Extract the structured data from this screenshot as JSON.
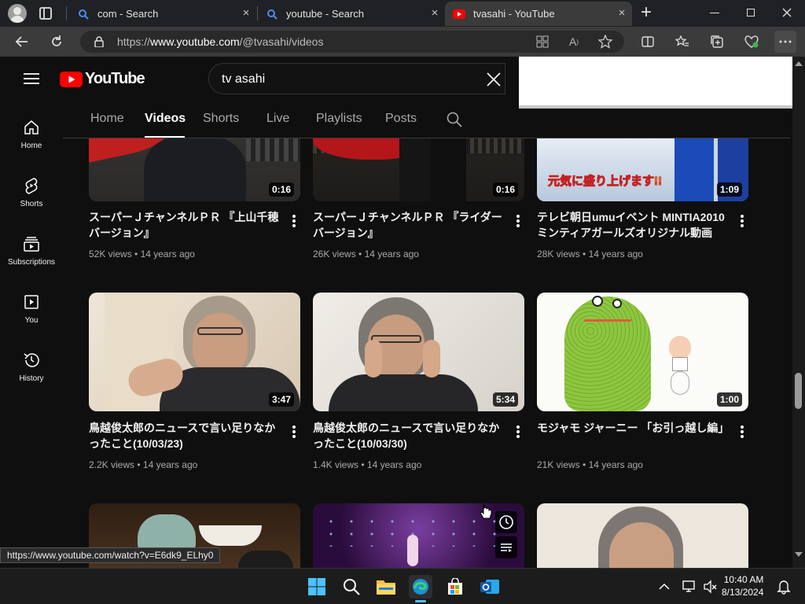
{
  "browser": {
    "tabs": [
      {
        "label": "com - Search",
        "icon": "search-icon"
      },
      {
        "label": "youtube - Search",
        "icon": "search-icon"
      },
      {
        "label": "tvasahi - YouTube",
        "icon": "youtube-icon"
      }
    ],
    "url_prefix": "https://",
    "url_host": "www.youtube.com",
    "url_path": "/@tvasahi/videos",
    "new_tab": "+",
    "close": "×"
  },
  "youtube": {
    "logo_text": "YouTube",
    "search_value": "tv asahi",
    "sidebar": [
      {
        "label": "Home",
        "icon": "home-icon"
      },
      {
        "label": "Shorts",
        "icon": "shorts-icon"
      },
      {
        "label": "Subscriptions",
        "icon": "subscriptions-icon"
      },
      {
        "label": "You",
        "icon": "you-icon"
      },
      {
        "label": "History",
        "icon": "history-icon"
      }
    ],
    "channel_tabs": [
      "Home",
      "Videos",
      "Shorts",
      "Live",
      "Playlists",
      "Posts"
    ],
    "active_tab": "Videos",
    "videos": [
      {
        "title": "スーパーＪチャンネルＰＲ 『上山千穂バージョン』",
        "views": "52K views",
        "age": "14 years ago",
        "duration": "0:16"
      },
      {
        "title": "スーパーＪチャンネルＰＲ 『ライダーバージョン』",
        "views": "26K views",
        "age": "14 years ago",
        "duration": "0:16"
      },
      {
        "title": "テレビ朝日umuイベント MINTIA2010 ミンティアガールズオリジナル動画",
        "views": "28K views",
        "age": "14 years ago",
        "duration": "1:09"
      },
      {
        "title": "鳥越俊太郎のニュースで言い足りなかったこと(10/03/23)",
        "views": "2.2K views",
        "age": "14 years ago",
        "duration": "3:47"
      },
      {
        "title": "鳥越俊太郎のニュースで言い足りなかったこと(10/03/30)",
        "views": "1.4K views",
        "age": "14 years ago",
        "duration": "5:34"
      },
      {
        "title": "モジャモ ジャーニー 「お引っ越し編」",
        "views": "21K views",
        "age": "14 years ago",
        "duration": "1:00"
      }
    ],
    "thumb_overlay_text": "元気に盛り上げます!!"
  },
  "status_url": "https://www.youtube.com/watch?v=E6dk9_ELhy0",
  "taskbar": {
    "time": "10:40 AM",
    "date": "8/13/2024"
  },
  "colors": {
    "youtube_red": "#ff0000",
    "background": "#0f0f0f",
    "browser_chrome": "#3b3b3b"
  }
}
